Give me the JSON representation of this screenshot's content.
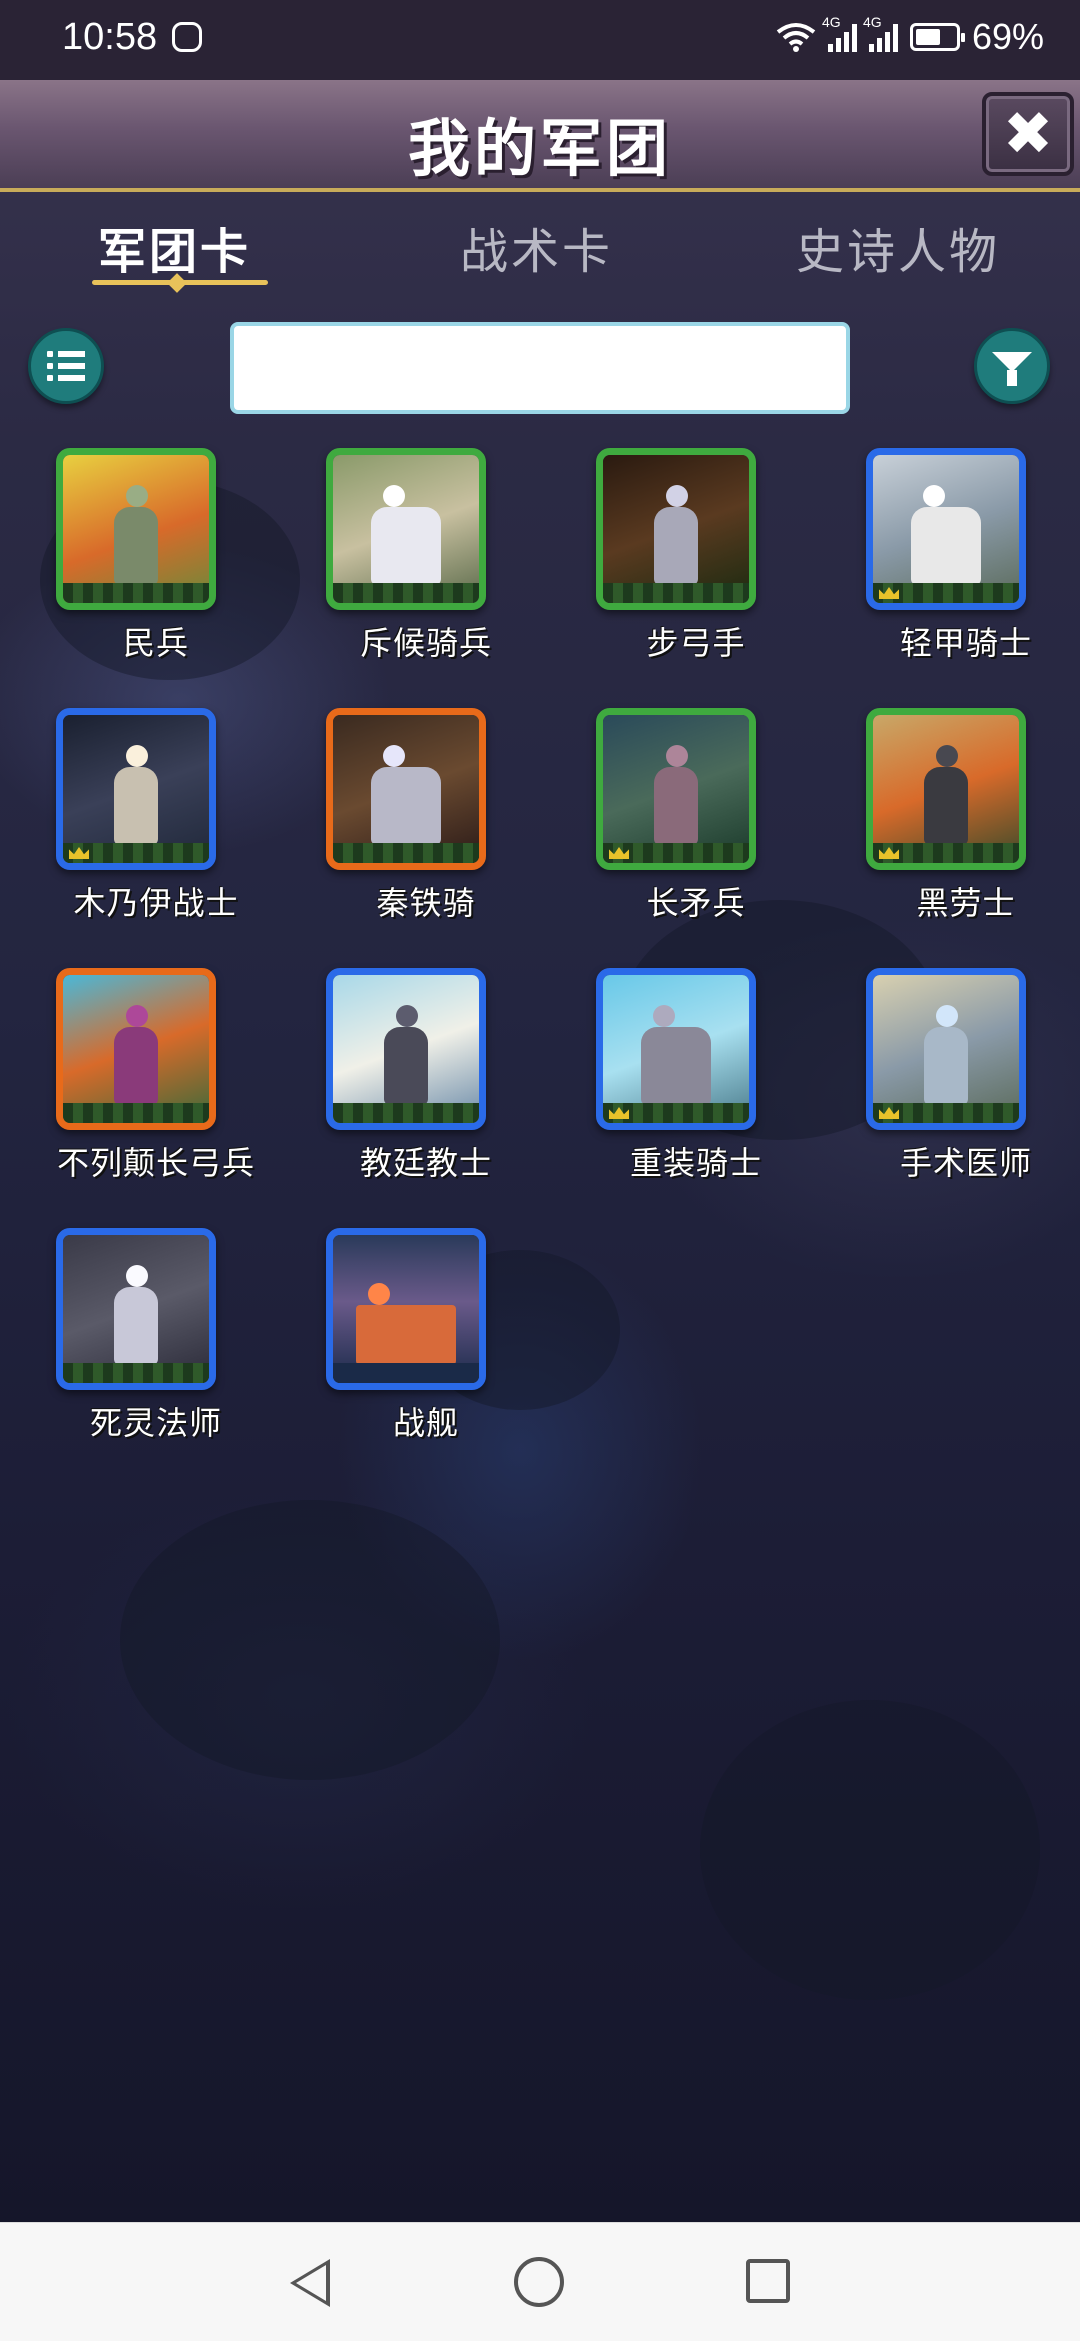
{
  "status_bar": {
    "time": "10:58",
    "network_1": "4G",
    "network_2": "4G",
    "battery": "69%"
  },
  "header": {
    "title": "我的军团",
    "close_icon": "close-icon"
  },
  "tabs": [
    {
      "label": "军团卡",
      "active": true
    },
    {
      "label": "战术卡",
      "active": false
    },
    {
      "label": "史诗人物",
      "active": false
    }
  ],
  "toolbar": {
    "list_icon": "list-icon",
    "filter_icon": "filter-icon",
    "search_value": ""
  },
  "cards": [
    {
      "name": "民兵",
      "rarity": "green",
      "crown": false
    },
    {
      "name": "斥候骑兵",
      "rarity": "green",
      "crown": false
    },
    {
      "name": "步弓手",
      "rarity": "green",
      "crown": false
    },
    {
      "name": "轻甲骑士",
      "rarity": "blue",
      "crown": true
    },
    {
      "name": "木乃伊战士",
      "rarity": "blue",
      "crown": true
    },
    {
      "name": "秦铁骑",
      "rarity": "orange",
      "crown": false
    },
    {
      "name": "长矛兵",
      "rarity": "green",
      "crown": true
    },
    {
      "name": "黑劳士",
      "rarity": "green",
      "crown": true
    },
    {
      "name": "不列颠长弓兵",
      "rarity": "orange",
      "crown": false
    },
    {
      "name": "教廷教士",
      "rarity": "blue",
      "crown": false
    },
    {
      "name": "重装骑士",
      "rarity": "blue",
      "crown": true
    },
    {
      "name": "手术医师",
      "rarity": "blue",
      "crown": true
    },
    {
      "name": "死灵法师",
      "rarity": "blue",
      "crown": false
    },
    {
      "name": "战舰",
      "rarity": "blue",
      "crown": false
    }
  ],
  "colors": {
    "green": "#4cb84a",
    "blue": "#2a6ae8",
    "orange": "#e86a1a",
    "accent_gold": "#e8c25a",
    "button_teal": "#1f7c7c"
  }
}
